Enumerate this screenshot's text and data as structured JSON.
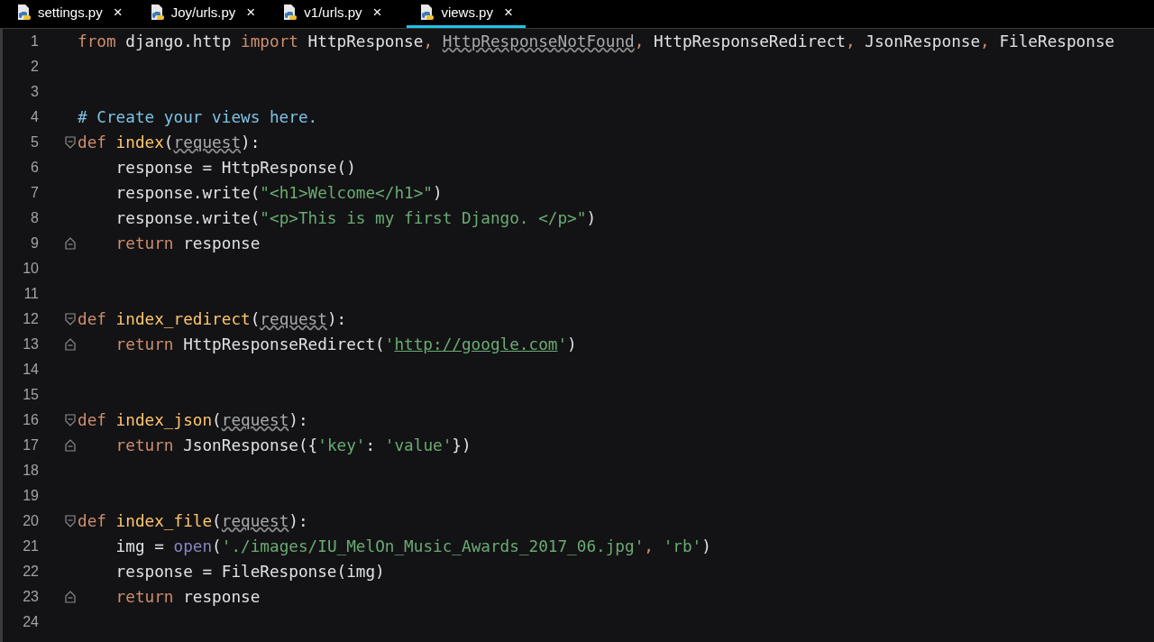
{
  "tabs": [
    {
      "label": "settings.py",
      "close": "×",
      "selected": false
    },
    {
      "label": "Joy/urls.py",
      "close": "×",
      "selected": false
    },
    {
      "label": "v1/urls.py",
      "close": "×",
      "selected": false
    },
    {
      "label": "views.py",
      "close": "×",
      "selected": true
    }
  ],
  "lines": [
    {
      "number": "1",
      "kind": "plain",
      "tokens": [
        {
          "kind": "keyword",
          "text": "from "
        },
        {
          "kind": "plain",
          "text": "django.http "
        },
        {
          "kind": "keyword",
          "text": "import "
        },
        {
          "kind": "plain",
          "text": "HttpResponse"
        },
        {
          "kind": "keyword",
          "text": ", "
        },
        {
          "kind": "unused",
          "text": "HttpResponseNotFound"
        },
        {
          "kind": "keyword",
          "text": ", "
        },
        {
          "kind": "plain",
          "text": "HttpResponseRedirect"
        },
        {
          "kind": "keyword",
          "text": ", "
        },
        {
          "kind": "plain",
          "text": "JsonResponse"
        },
        {
          "kind": "keyword",
          "text": ", "
        },
        {
          "kind": "plain",
          "text": "FileResponse"
        }
      ]
    },
    {
      "number": "2",
      "kind": "plain"
    },
    {
      "number": "3",
      "kind": "plain"
    },
    {
      "number": "4",
      "kind": "plain",
      "tokens": [
        {
          "kind": "comment",
          "text": "# Create your views here."
        }
      ]
    },
    {
      "number": "5",
      "kind": "foldstart",
      "tokens": [
        {
          "kind": "keyword",
          "text": "def "
        },
        {
          "kind": "func",
          "text": "index"
        },
        {
          "kind": "plain",
          "text": "("
        },
        {
          "kind": "unused",
          "text": "request"
        },
        {
          "kind": "plain",
          "text": "):"
        }
      ]
    },
    {
      "number": "6",
      "kind": "plain",
      "tokens": [
        {
          "kind": "plain",
          "text": "    response = HttpResponse()"
        }
      ]
    },
    {
      "number": "7",
      "kind": "plain",
      "tokens": [
        {
          "kind": "plain",
          "text": "    response.write("
        },
        {
          "kind": "string",
          "text": "\"<h1>Welcome</h1>\""
        },
        {
          "kind": "plain",
          "text": ")"
        }
      ]
    },
    {
      "number": "8",
      "kind": "plain",
      "tokens": [
        {
          "kind": "plain",
          "text": "    response.write("
        },
        {
          "kind": "string",
          "text": "\"<p>This is my first Django. </p>\""
        },
        {
          "kind": "plain",
          "text": ")"
        }
      ]
    },
    {
      "number": "9",
      "kind": "foldend",
      "tokens": [
        {
          "kind": "keyword",
          "text": "    return "
        },
        {
          "kind": "plain",
          "text": "response"
        }
      ]
    },
    {
      "number": "10",
      "kind": "plain"
    },
    {
      "number": "11",
      "kind": "plain"
    },
    {
      "number": "12",
      "kind": "foldstart",
      "tokens": [
        {
          "kind": "keyword",
          "text": "def "
        },
        {
          "kind": "func",
          "text": "index_redirect"
        },
        {
          "kind": "plain",
          "text": "("
        },
        {
          "kind": "unused",
          "text": "request"
        },
        {
          "kind": "plain",
          "text": "):"
        }
      ]
    },
    {
      "number": "13",
      "kind": "foldend",
      "tokens": [
        {
          "kind": "keyword",
          "text": "    return "
        },
        {
          "kind": "plain",
          "text": "HttpResponseRedirect("
        },
        {
          "kind": "string",
          "text": "'"
        },
        {
          "kind": "link",
          "text": "http://google.com"
        },
        {
          "kind": "string",
          "text": "'"
        },
        {
          "kind": "plain",
          "text": ")"
        }
      ]
    },
    {
      "number": "14",
      "kind": "plain"
    },
    {
      "number": "15",
      "kind": "plain"
    },
    {
      "number": "16",
      "kind": "foldstart",
      "tokens": [
        {
          "kind": "keyword",
          "text": "def "
        },
        {
          "kind": "func",
          "text": "index_json"
        },
        {
          "kind": "plain",
          "text": "("
        },
        {
          "kind": "unused",
          "text": "request"
        },
        {
          "kind": "plain",
          "text": "):"
        }
      ]
    },
    {
      "number": "17",
      "kind": "foldend",
      "tokens": [
        {
          "kind": "keyword",
          "text": "    return "
        },
        {
          "kind": "plain",
          "text": "JsonResponse({"
        },
        {
          "kind": "string",
          "text": "'key'"
        },
        {
          "kind": "plain",
          "text": ": "
        },
        {
          "kind": "string",
          "text": "'value'"
        },
        {
          "kind": "plain",
          "text": "})"
        }
      ]
    },
    {
      "number": "18",
      "kind": "plain"
    },
    {
      "number": "19",
      "kind": "plain"
    },
    {
      "number": "20",
      "kind": "foldstart",
      "tokens": [
        {
          "kind": "keyword",
          "text": "def "
        },
        {
          "kind": "func",
          "text": "index_file"
        },
        {
          "kind": "plain",
          "text": "("
        },
        {
          "kind": "unused",
          "text": "request"
        },
        {
          "kind": "plain",
          "text": "):"
        }
      ]
    },
    {
      "number": "21",
      "kind": "plain",
      "tokens": [
        {
          "kind": "plain",
          "text": "    img = "
        },
        {
          "kind": "builtin",
          "text": "open"
        },
        {
          "kind": "plain",
          "text": "("
        },
        {
          "kind": "string",
          "text": "'./images/IU_MelOn_Music_Awards_2017_06.jpg'"
        },
        {
          "kind": "keyword",
          "text": ", "
        },
        {
          "kind": "string",
          "text": "'rb'"
        },
        {
          "kind": "plain",
          "text": ")"
        }
      ]
    },
    {
      "number": "22",
      "kind": "plain",
      "tokens": [
        {
          "kind": "plain",
          "text": "    response = FileResponse(img)"
        }
      ]
    },
    {
      "number": "23",
      "kind": "foldend",
      "tokens": [
        {
          "kind": "keyword",
          "text": "    return "
        },
        {
          "kind": "plain",
          "text": "response"
        }
      ]
    },
    {
      "number": "24",
      "kind": "plain"
    }
  ]
}
